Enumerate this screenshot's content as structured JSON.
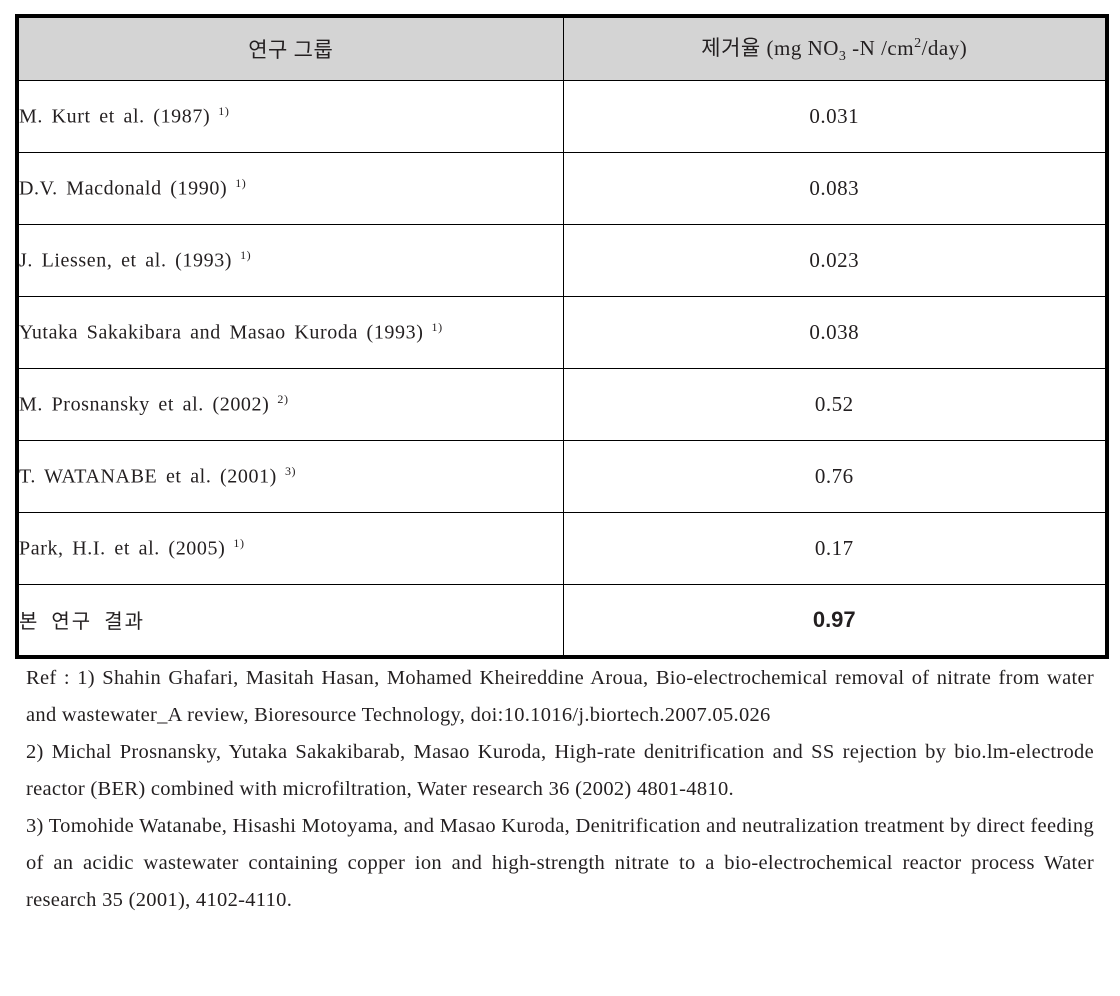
{
  "table": {
    "headers": {
      "group": "연구 그룹",
      "rate_prefix": "제거율 (mg NO",
      "rate_sub": "3",
      "rate_mid": " -N /cm",
      "rate_sup": "2",
      "rate_suffix": "/day)"
    },
    "rows": [
      {
        "group": "M. Kurt et al. (1987)",
        "ref": "1)",
        "rate": "0.031",
        "highlight": false
      },
      {
        "group": "D.V. Macdonald (1990)",
        "ref": "1)",
        "rate": "0.083",
        "highlight": false
      },
      {
        "group": "J. Liessen, et al. (1993)",
        "ref": "1)",
        "rate": "0.023",
        "highlight": false
      },
      {
        "group": "Yutaka Sakakibara and Masao Kuroda (1993)",
        "ref": "1)",
        "rate": "0.038",
        "highlight": false
      },
      {
        "group": "M. Prosnansky et al. (2002)",
        "ref": "2)",
        "rate": "0.52",
        "highlight": false
      },
      {
        "group": "T. WATANABE et al. (2001)",
        "ref": "3)",
        "rate": "0.76",
        "highlight": false
      },
      {
        "group": "Park, H.I. et al. (2005)",
        "ref": "1)",
        "rate": "0.17",
        "highlight": false
      },
      {
        "group": "본 연구 결과",
        "ref": "",
        "rate": "0.97",
        "highlight": true
      }
    ]
  },
  "references": {
    "ref1": "Ref : 1) Shahin Ghafari, Masitah Hasan, Mohamed Kheireddine Aroua, Bio-electrochemical removal of nitrate from water and wastewater_A review, Bioresource Technology, doi:10.1016/j.biortech.2007.05.026",
    "ref2": "2) Michal Prosnansky, Yutaka Sakakibarab, Masao Kuroda, High-rate denitrification and SS rejection by bio.lm-electrode reactor (BER) combined with microfiltration, Water research 36 (2002) 4801-4810.",
    "ref3": "3) Tomohide Watanabe, Hisashi Motoyama, and Masao Kuroda, Denitrification and neutralization treatment by direct feeding of an acidic wastewater containing copper ion and high-strength nitrate to a bio-electrochemical reactor process Water research 35 (2001), 4102-4110."
  },
  "colors": {
    "header_fill": "#d4d4d4",
    "border": "#000000",
    "text": "#231f20"
  }
}
